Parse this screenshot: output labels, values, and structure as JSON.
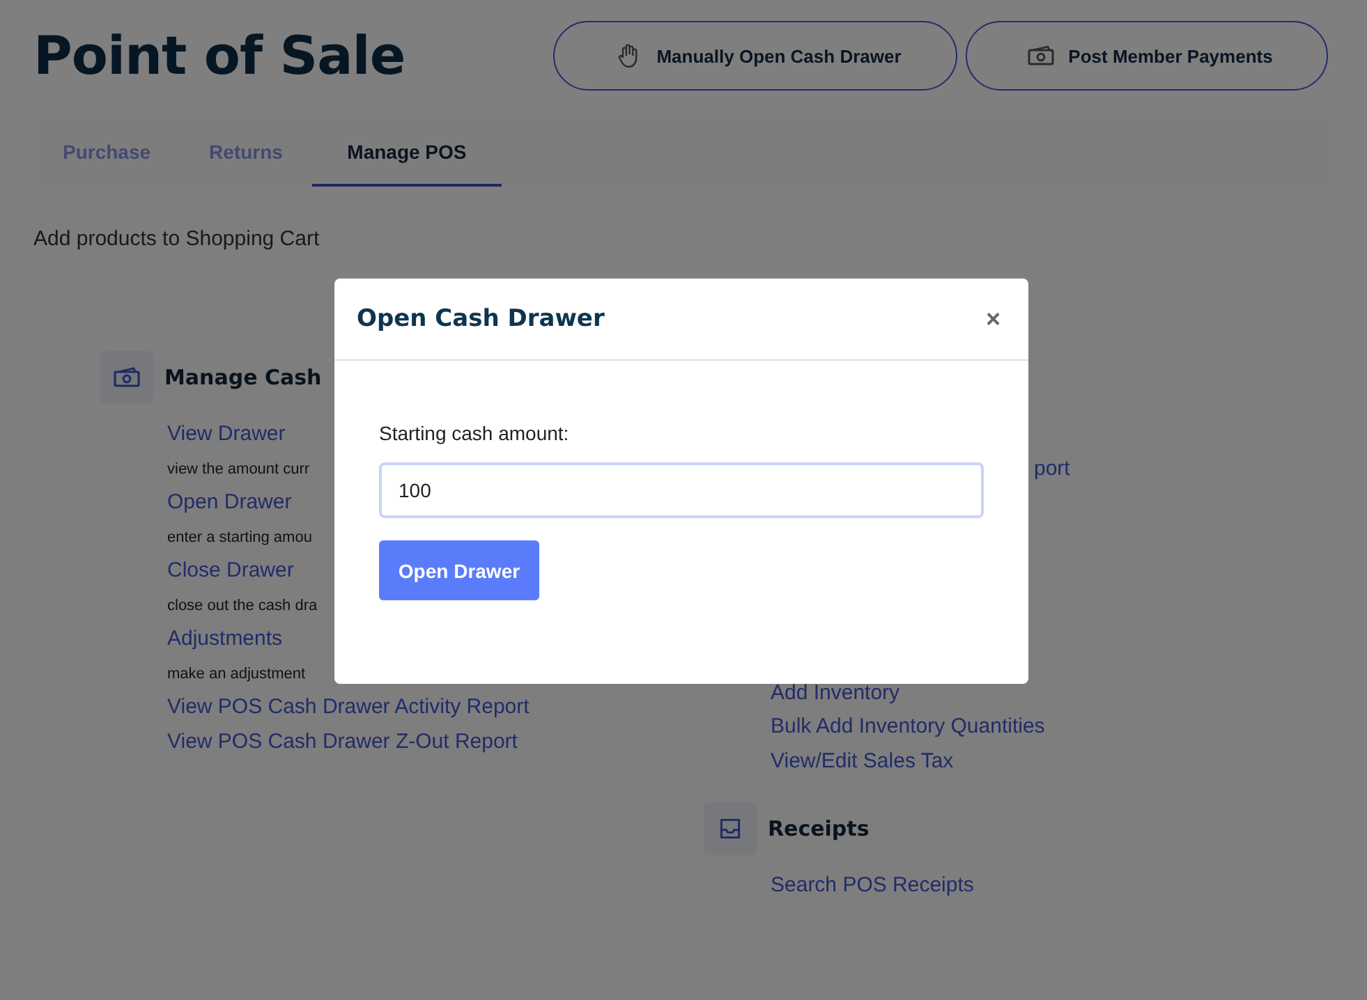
{
  "page": {
    "title": "Point of Sale"
  },
  "actions": [
    {
      "label": "Manually Open Cash Drawer"
    },
    {
      "label": "Post Member Payments"
    }
  ],
  "tabs": [
    {
      "label": "Purchase",
      "selected": false
    },
    {
      "label": "Returns",
      "selected": false
    },
    {
      "label": "Manage POS",
      "selected": true
    }
  ],
  "subtitle": "Add products to Shopping Cart",
  "cash_section": {
    "title": "Manage Cash",
    "links": [
      {
        "label": "View Drawer",
        "description": "view the amount curr"
      },
      {
        "label": "Open Drawer",
        "description": "enter a starting amou"
      },
      {
        "label": "Close Drawer",
        "description": "close out the cash dra"
      },
      {
        "label": "Adjustments",
        "description": "make an adjustment"
      },
      {
        "label": "View POS Cash Drawer Activity Report"
      },
      {
        "label": "View POS Cash Drawer Z-Out Report"
      }
    ]
  },
  "inventory_section": {
    "partial_link": "port",
    "links": [
      "Add Inventory",
      "Bulk Add Inventory Quantities",
      "View/Edit Sales Tax"
    ]
  },
  "receipts_section": {
    "title": "Receipts",
    "links": [
      "Search POS Receipts"
    ]
  },
  "modal": {
    "title": "Open Cash Drawer",
    "close": "×",
    "label": "Starting cash amount:",
    "value": "100",
    "button": "Open Drawer"
  }
}
